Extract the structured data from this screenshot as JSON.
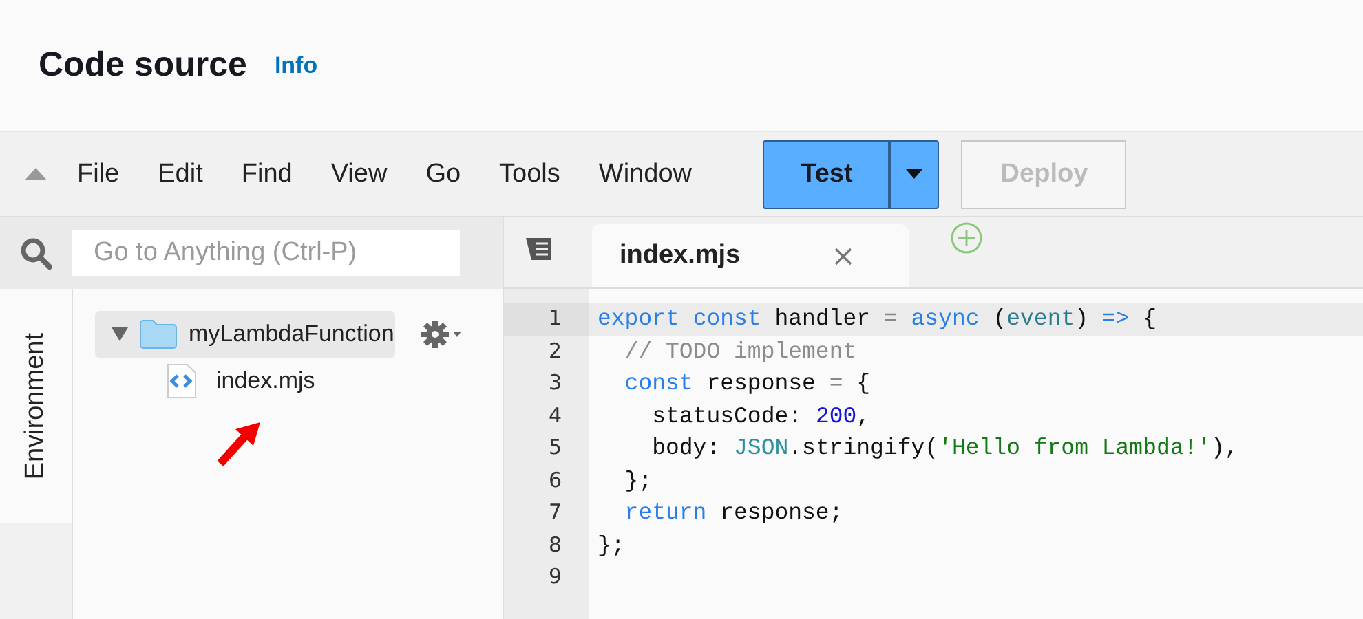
{
  "header": {
    "title": "Code source",
    "info_link": "Info"
  },
  "toolbar": {
    "menus": [
      "File",
      "Edit",
      "Find",
      "View",
      "Go",
      "Tools",
      "Window"
    ],
    "test_button": {
      "label": "Test",
      "disabled": false
    },
    "deploy_button": {
      "label": "Deploy",
      "disabled": true
    }
  },
  "sidebar": {
    "search": {
      "placeholder": "Go to Anything (Ctrl-P)"
    },
    "vertical_tab": {
      "label": "Environment",
      "selected": true
    },
    "tree": [
      {
        "name": "myLambdaFunction",
        "kind": "folder",
        "expanded": true,
        "selected": true,
        "children": [
          {
            "name": "index.mjs",
            "kind": "file",
            "selected": false
          }
        ]
      }
    ]
  },
  "editor": {
    "tabs": [
      {
        "label": "index.mjs",
        "selected": true
      }
    ],
    "lines": [
      {
        "number": "1",
        "active": true,
        "tokens": [
          {
            "kind": "keyword",
            "text": "export"
          },
          {
            "kind": "keyword",
            "text": " const"
          },
          {
            "kind": "plain",
            "text": " handler "
          },
          {
            "kind": "operator",
            "text": "="
          },
          {
            "kind": "keyword",
            "text": " async"
          },
          {
            "kind": "plain",
            "text": " ("
          },
          {
            "kind": "param",
            "text": "event"
          },
          {
            "kind": "plain",
            "text": ") "
          },
          {
            "kind": "keyword",
            "text": "=>"
          },
          {
            "kind": "plain",
            "text": " {"
          }
        ]
      },
      {
        "number": "2",
        "active": false,
        "tokens": [
          {
            "kind": "comment",
            "text": "  // TODO implement"
          }
        ]
      },
      {
        "number": "3",
        "active": false,
        "tokens": [
          {
            "kind": "keyword",
            "text": "  const"
          },
          {
            "kind": "plain",
            "text": " response "
          },
          {
            "kind": "operator",
            "text": "="
          },
          {
            "kind": "plain",
            "text": " {"
          }
        ]
      },
      {
        "number": "4",
        "active": false,
        "tokens": [
          {
            "kind": "plain",
            "text": "    statusCode: "
          },
          {
            "kind": "number",
            "text": "200"
          },
          {
            "kind": "plain",
            "text": ","
          }
        ]
      },
      {
        "number": "5",
        "active": false,
        "tokens": [
          {
            "kind": "plain",
            "text": "    body: "
          },
          {
            "kind": "builtin",
            "text": "JSON"
          },
          {
            "kind": "plain",
            "text": ".stringify("
          },
          {
            "kind": "string",
            "text": "'Hello from Lambda!'"
          },
          {
            "kind": "plain",
            "text": "),"
          }
        ]
      },
      {
        "number": "6",
        "active": false,
        "tokens": [
          {
            "kind": "plain",
            "text": "  };"
          }
        ]
      },
      {
        "number": "7",
        "active": false,
        "tokens": [
          {
            "kind": "keyword",
            "text": "  return"
          },
          {
            "kind": "plain",
            "text": " response;"
          }
        ]
      },
      {
        "number": "8",
        "active": false,
        "tokens": [
          {
            "kind": "plain",
            "text": "};"
          }
        ]
      },
      {
        "number": "9",
        "active": false
      }
    ]
  }
}
